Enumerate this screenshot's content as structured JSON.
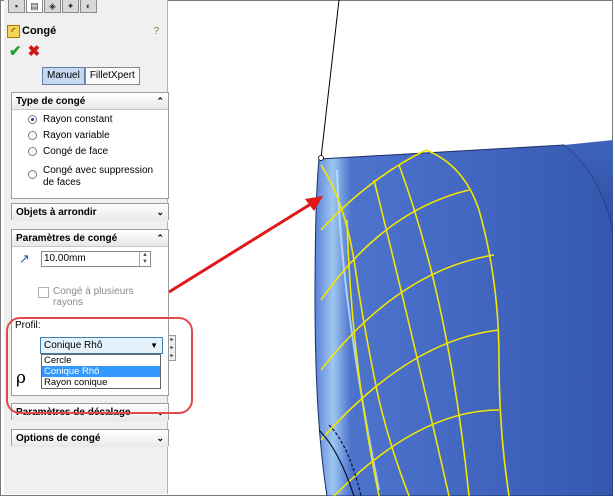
{
  "tabs": [
    "feature-manager-tab",
    "property-manager-tab",
    "configuration-manager-tab",
    "dim-xpert-tab",
    "display-manager-tab"
  ],
  "header": {
    "title": "Congé"
  },
  "actions": {
    "ok_icon": "check-icon",
    "cancel_icon": "close-icon"
  },
  "mode": {
    "manual": "Manuel",
    "filletxpert": "FilletXpert"
  },
  "fillet_type": {
    "title": "Type de congé",
    "options": [
      "Rayon constant",
      "Rayon variable",
      "Congé de face",
      "Congé avec suppression de faces"
    ],
    "selected": 0
  },
  "objects": {
    "title": "Objets à arrondir"
  },
  "params": {
    "title": "Paramètres de congé",
    "radius": "10.00mm",
    "multi_radius": "Congé à plusieurs rayons",
    "profile_label": "Profil:",
    "profile_value": "Conique Rhô",
    "profile_options": [
      "Cercle",
      "Conique Rhô",
      "Rayon conique"
    ],
    "rho_symbol": "ρ"
  },
  "offset": {
    "title": "Paramètres de décalage"
  },
  "options": {
    "title": "Options de congé"
  },
  "colors": {
    "accent": "#3399ff",
    "callout": "#e01818",
    "model": "#4a6fc8",
    "edges": "#f2e600"
  }
}
